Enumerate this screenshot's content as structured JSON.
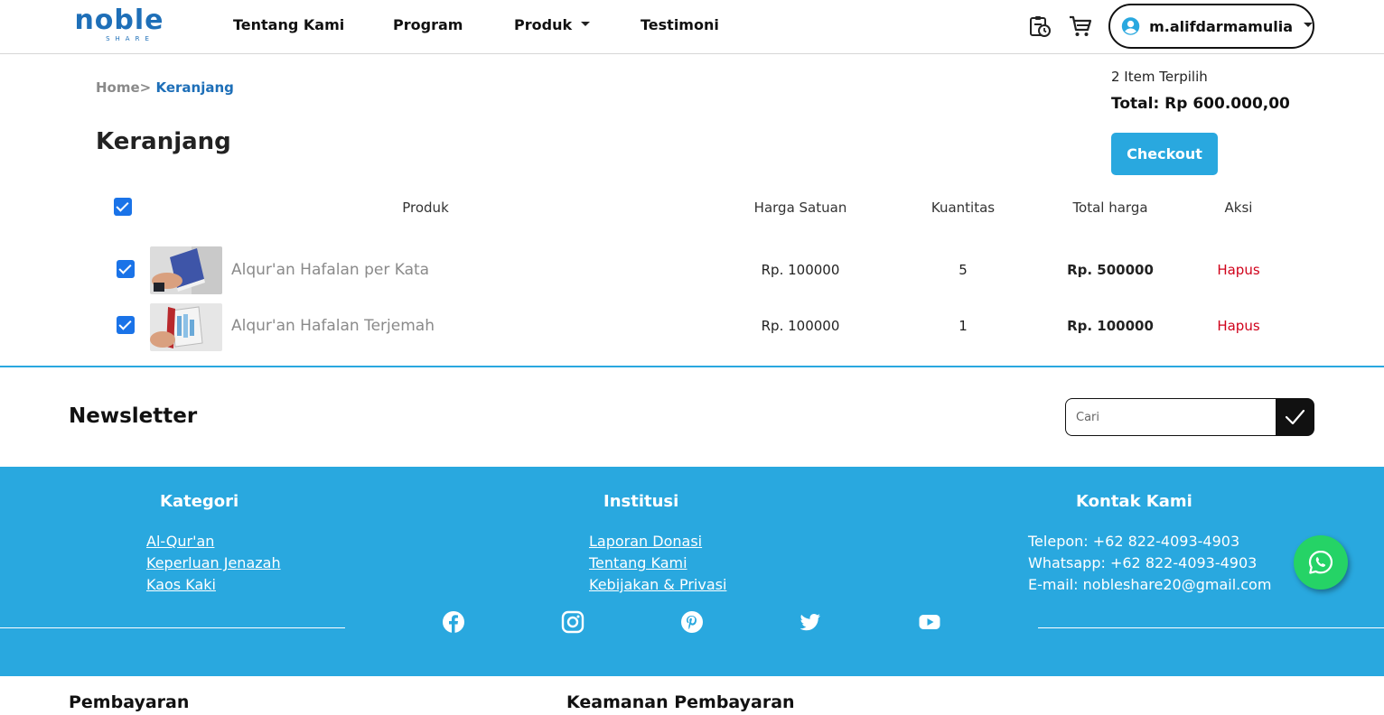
{
  "header": {
    "logo_main": "noble",
    "logo_sub": "SHARE",
    "nav": [
      {
        "label": "Tentang Kami"
      },
      {
        "label": "Program"
      },
      {
        "label": "Produk"
      },
      {
        "label": "Testimoni"
      }
    ],
    "icons": [
      "history-clipboard-icon",
      "cart-icon"
    ],
    "user": {
      "name": "m.alifdarmamulia",
      "icon": "account-circle-icon"
    }
  },
  "breadcrumb": {
    "home": "Home",
    "separator": ">",
    "current": "Keranjang"
  },
  "page_title": "Keranjang",
  "summary": {
    "count_text": "2 Item Terpilih",
    "total_text": "Total: Rp 600.000,00",
    "checkout_label": "Checkout"
  },
  "cart_table": {
    "columns": [
      "Produk",
      "Harga Satuan",
      "Kuantitas",
      "Total harga",
      "Aksi"
    ],
    "select_all_checked": true,
    "rows": [
      {
        "checked": true,
        "name": "Alqur'an Hafalan per Kata",
        "unit_price": "Rp. 100000",
        "quantity": "5",
        "total": "Rp. 500000",
        "action": "Hapus"
      },
      {
        "checked": true,
        "name": "Alqur'an Hafalan Terjemah",
        "unit_price": "Rp. 100000",
        "quantity": "1",
        "total": "Rp. 100000",
        "action": "Hapus"
      }
    ]
  },
  "newsletter": {
    "title": "Newsletter",
    "placeholder": "Cari",
    "submit_icon": "checkmark-icon"
  },
  "footer": {
    "kategori": {
      "title": "Kategori",
      "links": [
        "Al-Qur'an",
        "Keperluan Jenazah",
        "Kaos Kaki"
      ]
    },
    "institusi": {
      "title": "Institusi",
      "links": [
        "Laporan Donasi",
        "Tentang Kami",
        "Kebijakan & Privasi"
      ]
    },
    "kontak": {
      "title": "Kontak Kami",
      "lines": [
        "Telepon: +62 822-4093-4903",
        "Whatsapp: +62 822-4093-4903",
        "E-mail: nobleshare20@gmail.com"
      ]
    },
    "social_icons": [
      "facebook-icon",
      "instagram-icon",
      "pinterest-icon",
      "twitter-icon",
      "youtube-icon"
    ],
    "bottom_headings": [
      "Pembayaran",
      "Keamanan Pembayaran"
    ]
  },
  "colors": {
    "brand_blue": "#29a8df",
    "link_blue": "#1e6fb8",
    "danger_red": "#d0021b",
    "checkbox_blue": "#1a73e8",
    "whatsapp_green": "#25d366"
  }
}
